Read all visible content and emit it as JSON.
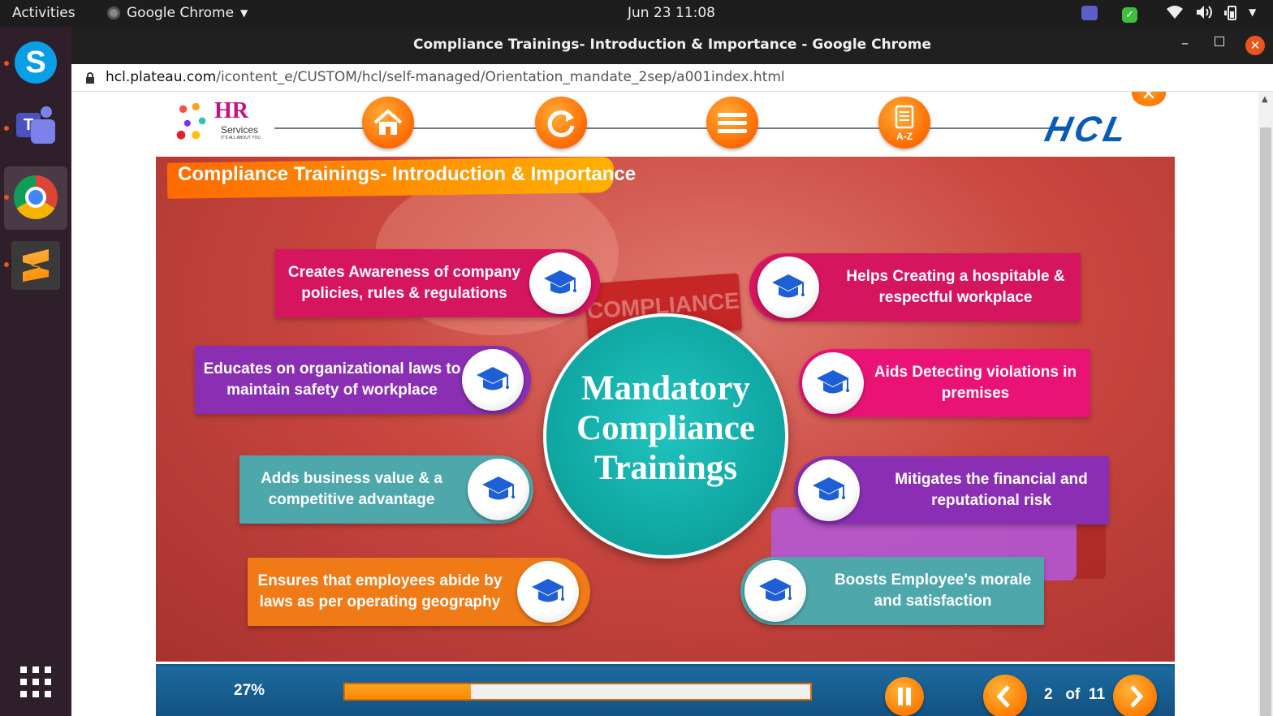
{
  "topbar": {
    "activities": "Activities",
    "app_menu": "Google Chrome",
    "clock": "Jun 23  11:08"
  },
  "window": {
    "title": "Compliance Trainings- Introduction & Importance - Google Chrome"
  },
  "address_bar": {
    "host": "hcl.plateau.com",
    "path": "/icontent_e/CUSTOM/hcl/self-managed/Orientation_mandate_2sep/a001index.html"
  },
  "course_nav": {
    "logo_left": "HR Services",
    "logo_left_tagline": "IT'S ALL ABOUT YOU",
    "logo_right": "HCL",
    "glossary_label": "A-Z",
    "buttons": [
      "home-icon",
      "replay-icon",
      "menu-icon",
      "glossary-icon"
    ]
  },
  "slide": {
    "heading": "Compliance Trainings- Introduction & Importance",
    "center_title": [
      "Mandatory",
      "Compliance",
      "Trainings"
    ],
    "background_sign": "COMPLIANCE",
    "cards_left": [
      {
        "text": "Creates Awareness of company policies, rules & regulations",
        "color": "#d6155f"
      },
      {
        "text": "Educates on organizational laws to maintain safety of workplace",
        "color": "#8a2fb4"
      },
      {
        "text": "Adds business value & a competitive advantage",
        "color": "#4ea8ab"
      },
      {
        "text": "Ensures that employees abide by laws as per operating geography",
        "color": "#f07a16"
      }
    ],
    "cards_right": [
      {
        "text": "Helps Creating a hospitable & respectful workplace",
        "color": "#d6155f"
      },
      {
        "text": "Aids Detecting violations in premises",
        "color": "#ea1375"
      },
      {
        "text": "Mitigates the financial and reputational risk",
        "color": "#8a2fb4"
      },
      {
        "text": "Boosts Employee's morale and satisfaction",
        "color": "#4ea8ab"
      }
    ]
  },
  "player": {
    "progress_label": "27%",
    "progress_value": 0.27,
    "current_page": "2",
    "of_label": "of",
    "total_pages": "11"
  },
  "colors": {
    "accent_orange": "#ff7b00",
    "player_bar": "#16609a",
    "center_teal": "#14b3ae"
  }
}
